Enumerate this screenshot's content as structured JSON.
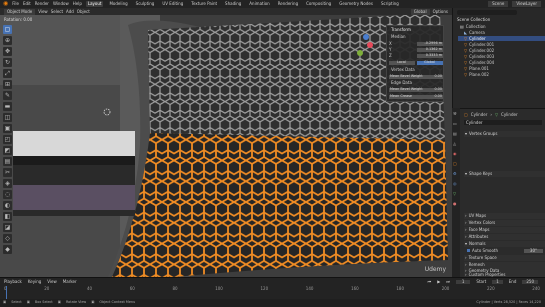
{
  "menu": {
    "items": [
      "File",
      "Edit",
      "Render",
      "Window",
      "Help"
    ],
    "workspaces": [
      "Layout",
      "Modeling",
      "Sculpting",
      "UV Editing",
      "Texture Paint",
      "Shading",
      "Animation",
      "Rendering",
      "Compositing",
      "Geometry Nodes",
      "Scripting"
    ],
    "active_workspace": "Layout",
    "scene": "Scene",
    "view_layer": "ViewLayer"
  },
  "viewport": {
    "mode_label": "Object Mode",
    "menus": [
      "View",
      "Select",
      "Add",
      "Object"
    ],
    "orientation_label": "Global",
    "hud_line": "Rotation: 0.00",
    "option_label": "Options"
  },
  "npanel": {
    "title": "Transform",
    "subtitle": "Median",
    "rows": [
      {
        "axis": "X",
        "value": "-0.2996 m"
      },
      {
        "axis": "Y",
        "value": "0.1362 m"
      },
      {
        "axis": "Z",
        "value": "0.3333 m"
      }
    ],
    "space_local": "Local",
    "space_global": "Global",
    "vertex_label": "Vertex Data",
    "vertex_weight": "Mean Bevel Weight",
    "vertex_weight_value": "0.00",
    "edge_label": "Edge Data",
    "edge_weight": "Mean Bevel Weight",
    "edge_weight_value": "0.00",
    "crease_label": "Mean Crease",
    "crease_value": "0.00"
  },
  "outliner": {
    "header": "Scene Collection",
    "items": [
      {
        "name": "Collection",
        "selected": false,
        "kind": "collection"
      },
      {
        "name": "Camera",
        "selected": false,
        "kind": "camera"
      },
      {
        "name": "Cylinder",
        "selected": true,
        "kind": "mesh"
      },
      {
        "name": "Cylinder.001",
        "selected": false,
        "kind": "mesh"
      },
      {
        "name": "Cylinder.002",
        "selected": false,
        "kind": "mesh"
      },
      {
        "name": "Cylinder.003",
        "selected": false,
        "kind": "mesh"
      },
      {
        "name": "Cylinder.004",
        "selected": false,
        "kind": "mesh"
      },
      {
        "name": "Plane.001",
        "selected": false,
        "kind": "mesh"
      },
      {
        "name": "Plane.002",
        "selected": false,
        "kind": "mesh"
      }
    ]
  },
  "properties": {
    "breadcrumb_object": "Cylinder",
    "breadcrumb_data": "Cylinder",
    "data_name": "Cylinder",
    "sections": [
      "Vertex Groups",
      "Shape Keys",
      "UV Maps",
      "Vertex Colors",
      "Face Maps",
      "Attributes",
      "Normals",
      "Texture Space",
      "Remesh",
      "Geometry Data",
      "Custom Properties"
    ],
    "auto_smooth_label": "Auto Smooth",
    "auto_smooth_value": "30°"
  },
  "timeline": {
    "playback": "Playback",
    "keying": "Keying",
    "view": "View",
    "marker": "Marker",
    "current_frame": "1",
    "start_label": "Start",
    "start": "1",
    "end_label": "End",
    "end": "250",
    "ticks": [
      "0",
      "20",
      "40",
      "60",
      "80",
      "100",
      "120",
      "140",
      "160",
      "180",
      "200",
      "220",
      "240"
    ]
  },
  "statusbar": {
    "items": [
      "Select",
      "Box Select",
      "Rotate View",
      "Object Context Menu"
    ],
    "stats": "Cylinder | Verts 28,520 | Faces 14,220"
  },
  "colors": {
    "accent": "#4772b3",
    "selection": "#f08c24",
    "outliner_selected": "#334d80"
  },
  "watermark": "Udemy"
}
